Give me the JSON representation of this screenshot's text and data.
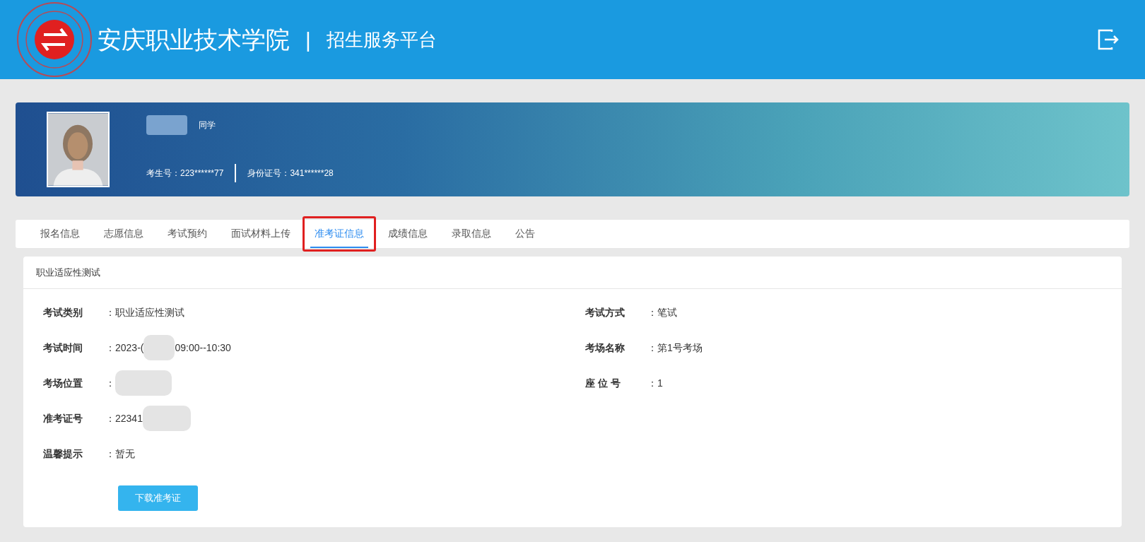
{
  "header": {
    "school": "安庆职业技术学院",
    "separator": "|",
    "platform": "招生服务平台"
  },
  "profile": {
    "name_redacted": true,
    "suffix": "同学",
    "exam_no": "考生号：223******77",
    "id_no": "身份证号：341******28"
  },
  "tabs": [
    {
      "label": "报名信息",
      "selected": false,
      "highlighted": false
    },
    {
      "label": "志愿信息",
      "selected": false,
      "highlighted": false
    },
    {
      "label": "考试预约",
      "selected": false,
      "highlighted": false
    },
    {
      "label": "面试材料上传",
      "selected": false,
      "highlighted": false
    },
    {
      "label": "准考证信息",
      "selected": true,
      "highlighted": true
    },
    {
      "label": "成绩信息",
      "selected": false,
      "highlighted": false
    },
    {
      "label": "录取信息",
      "selected": false,
      "highlighted": false
    },
    {
      "label": "公告",
      "selected": false,
      "highlighted": false
    }
  ],
  "card": {
    "title": "职业适应性测试",
    "left": [
      {
        "label": "考试类别",
        "value": "：职业适应性测试",
        "redacted": false
      },
      {
        "label": "考试时间",
        "value": "：2023-(",
        "redacted": true,
        "value_after": "09:00--10:30"
      },
      {
        "label": "考场位置",
        "value": "：",
        "redacted": true
      },
      {
        "label": "准考证号",
        "value": "：22341",
        "redacted": true
      },
      {
        "label": "温馨提示",
        "value": "：暂无",
        "redacted": false
      }
    ],
    "right": [
      {
        "label": "考试方式",
        "value": "：笔试",
        "redacted": false
      },
      {
        "label": "考场名称",
        "value": "：第1号考场",
        "redacted": false
      },
      {
        "label": "座 位 号",
        "value": "：1",
        "redacted": false
      }
    ],
    "button": "下载准考证"
  }
}
